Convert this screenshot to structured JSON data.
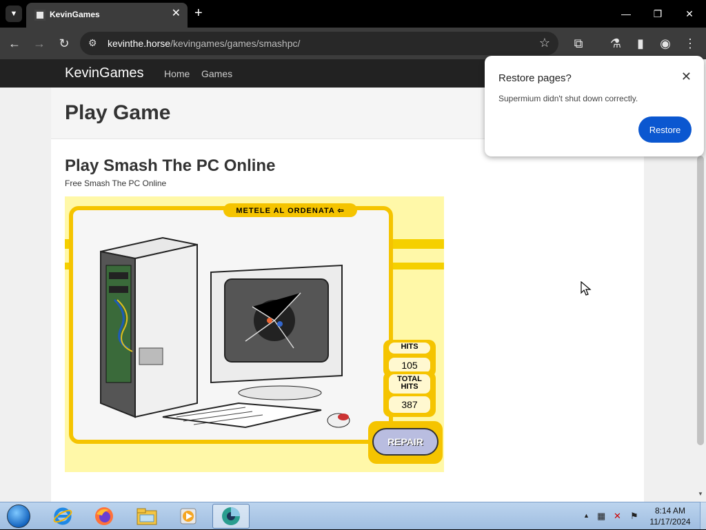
{
  "browser": {
    "tab_title": "KevinGames",
    "tab_close": "✕",
    "new_tab": "+",
    "url_host": "kevinthe.horse",
    "url_path": "/kevingames/games/smashpc/",
    "window_minimize": "—",
    "window_restore": "❐",
    "window_close": "✕"
  },
  "site": {
    "brand": "KevinGames",
    "nav": [
      "Home",
      "Games"
    ],
    "page_title": "Play Game",
    "game_title": "Play Smash The PC Online",
    "game_subtitle": "Free Smash The PC Online"
  },
  "game": {
    "banner": "METELE AL ORDENATA ⇦",
    "hits_label": "HITS",
    "hits_value": "105",
    "total_hits_label_1": "TOTAL",
    "total_hits_label_2": "HITS",
    "total_hits_value": "387",
    "repair_label": "REPAIR",
    "colors": {
      "background": "#fff8a8",
      "frame": "#f5c400",
      "counter_bg": "#fff8d0"
    }
  },
  "popup": {
    "title": "Restore pages?",
    "message": "Supermium didn't shut down correctly.",
    "restore_button": "Restore",
    "close": "✕"
  },
  "taskbar": {
    "time": "8:14 AM",
    "date": "11/17/2024",
    "apps": [
      "start-orb",
      "internet-explorer-icon",
      "firefox-icon",
      "file-explorer-icon",
      "media-player-icon",
      "supermium-icon"
    ]
  },
  "colors": {
    "accent_blue": "#0b57d0",
    "navbar_bg": "#222222",
    "chrome_dark": "#3c3c3c"
  }
}
